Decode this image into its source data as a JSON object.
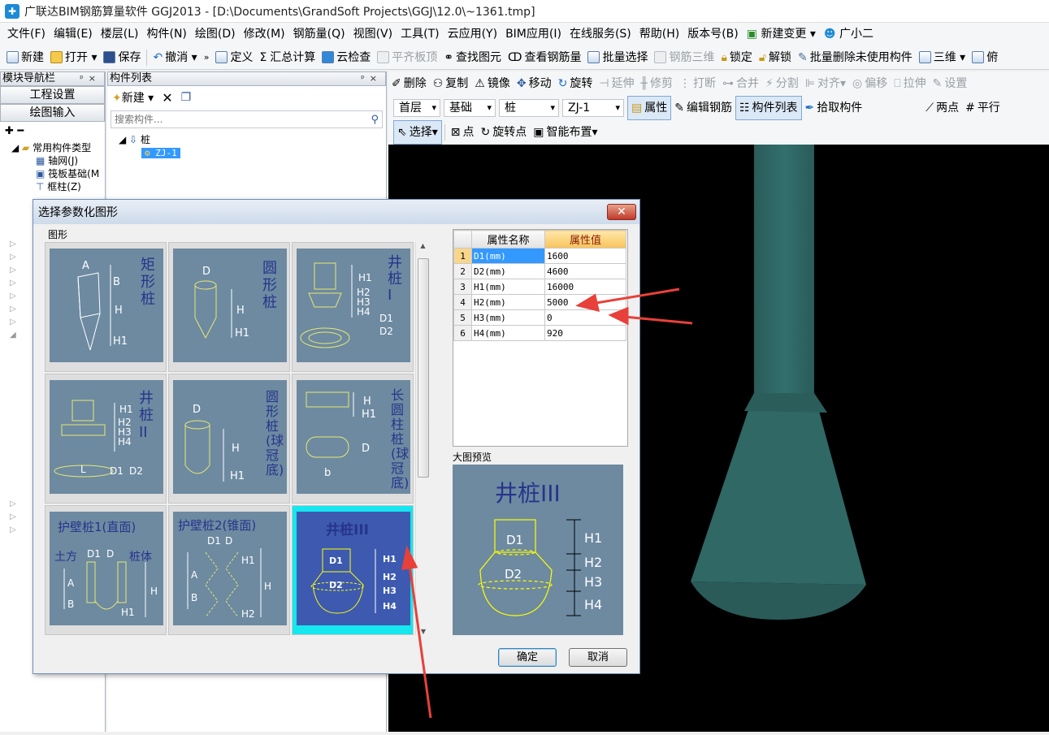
{
  "window": {
    "title": "广联达BIM钢筋算量软件 GGJ2013 - [D:\\Documents\\GrandSoft Projects\\GGJ\\12.0\\~1361.tmp]"
  },
  "menu": [
    "文件(F)",
    "编辑(E)",
    "楼层(L)",
    "构件(N)",
    "绘图(D)",
    "修改(M)",
    "钢筋量(Q)",
    "视图(V)",
    "工具(T)",
    "云应用(Y)",
    "BIM应用(I)",
    "在线服务(S)",
    "帮助(H)",
    "版本号(B)",
    "新建变更",
    "广小二"
  ],
  "toolbar1": [
    {
      "label": "新建",
      "disabled": false
    },
    {
      "label": "打开",
      "disabled": false
    },
    {
      "label": "保存",
      "disabled": false
    },
    {
      "label": "撤消",
      "disabled": false
    },
    {
      "label": "定义",
      "disabled": false
    },
    {
      "label": "汇总计算",
      "disabled": false
    },
    {
      "label": "云检查",
      "disabled": false
    },
    {
      "label": "平齐板顶",
      "disabled": true
    },
    {
      "label": "查找图元",
      "disabled": false
    },
    {
      "label": "查看钢筋量",
      "disabled": false
    },
    {
      "label": "批量选择",
      "disabled": false
    },
    {
      "label": "钢筋三维",
      "disabled": true
    },
    {
      "label": "锁定",
      "disabled": false
    },
    {
      "label": "解锁",
      "disabled": false
    },
    {
      "label": "批量删除未使用构件",
      "disabled": false
    },
    {
      "label": "三维",
      "disabled": false
    },
    {
      "label": "俯",
      "disabled": false
    }
  ],
  "nav_panel": {
    "title": "模块导航栏",
    "btn_project": "工程设置",
    "btn_draw": "绘图输入",
    "tree_root": "常用构件类型",
    "tree_items": [
      "轴网(J)",
      "筏板基础(M",
      "框柱(Z)"
    ]
  },
  "comp_panel": {
    "title": "构件列表",
    "new_label": "新建",
    "search_placeholder": "搜索构件...",
    "tree_root": "桩",
    "tree_child": "ZJ-1"
  },
  "toolbar2": [
    "删除",
    "复制",
    "镜像",
    "移动",
    "旋转",
    "延伸",
    "修剪",
    "打断",
    "合并",
    "分割",
    "对齐",
    "偏移",
    "拉伸",
    "设置"
  ],
  "toolbar2_disabled": [
    "延伸",
    "修剪",
    "打断",
    "合并",
    "分割",
    "对齐",
    "偏移",
    "拉伸",
    "设置"
  ],
  "toolbar3": {
    "floor": "首层",
    "category": "基础",
    "type": "桩",
    "component": "ZJ-1",
    "buttons": [
      "属性",
      "编辑钢筋",
      "构件列表",
      "拾取构件"
    ],
    "right_buttons": [
      "两点",
      "平行"
    ]
  },
  "toolbar4": [
    "选择",
    "点",
    "旋转点",
    "智能布置"
  ],
  "dialog": {
    "title": "选择参数化图形",
    "gallery_label": "图形",
    "shapes": [
      {
        "name": "矩形桩",
        "dims": [
          "A",
          "B",
          "H",
          "H1"
        ]
      },
      {
        "name": "圆形桩",
        "dims": [
          "D",
          "H",
          "H1"
        ]
      },
      {
        "name": "井桩I",
        "dims": [
          "H1",
          "H2",
          "H3",
          "H4",
          "D1",
          "D2"
        ]
      },
      {
        "name": "井桩II",
        "dims": [
          "H1",
          "H2",
          "H3",
          "H4",
          "L",
          "D1",
          "D2"
        ]
      },
      {
        "name": "圆形桩(球冠底)",
        "dims": [
          "D",
          "H",
          "H1"
        ]
      },
      {
        "name": "长圆柱桩(球冠底)",
        "dims": [
          "H",
          "H1",
          "D",
          "b"
        ]
      },
      {
        "name": "护壁桩1(直面)",
        "dims": [
          "土方",
          "D1",
          "D",
          "桩体",
          "A",
          "B",
          "H",
          "H1"
        ]
      },
      {
        "name": "护壁桩2(锥面)",
        "dims": [
          "D1",
          "D",
          "H1",
          "A",
          "B",
          "H",
          "H2"
        ]
      },
      {
        "name": "井桩III",
        "dims": [
          "D1",
          "D2",
          "H1",
          "H2",
          "H3",
          "H4"
        ]
      }
    ],
    "table_headers": [
      "属性名称",
      "属性值"
    ],
    "properties": [
      {
        "no": "1",
        "name": "D1(mm)",
        "value": "1600"
      },
      {
        "no": "2",
        "name": "D2(mm)",
        "value": "4600"
      },
      {
        "no": "3",
        "name": "H1(mm)",
        "value": "16000"
      },
      {
        "no": "4",
        "name": "H2(mm)",
        "value": "5000"
      },
      {
        "no": "5",
        "name": "H3(mm)",
        "value": "0"
      },
      {
        "no": "6",
        "name": "H4(mm)",
        "value": "920"
      }
    ],
    "preview_label": "大图预览",
    "preview_title": "井桩III",
    "ok": "确定",
    "cancel": "取消"
  },
  "colors": {
    "pile": "#2e6462",
    "canvas": "#000000",
    "tile": "#6d8aa1",
    "selected_border": "#16e6ee",
    "arrow": "#e8403a"
  }
}
